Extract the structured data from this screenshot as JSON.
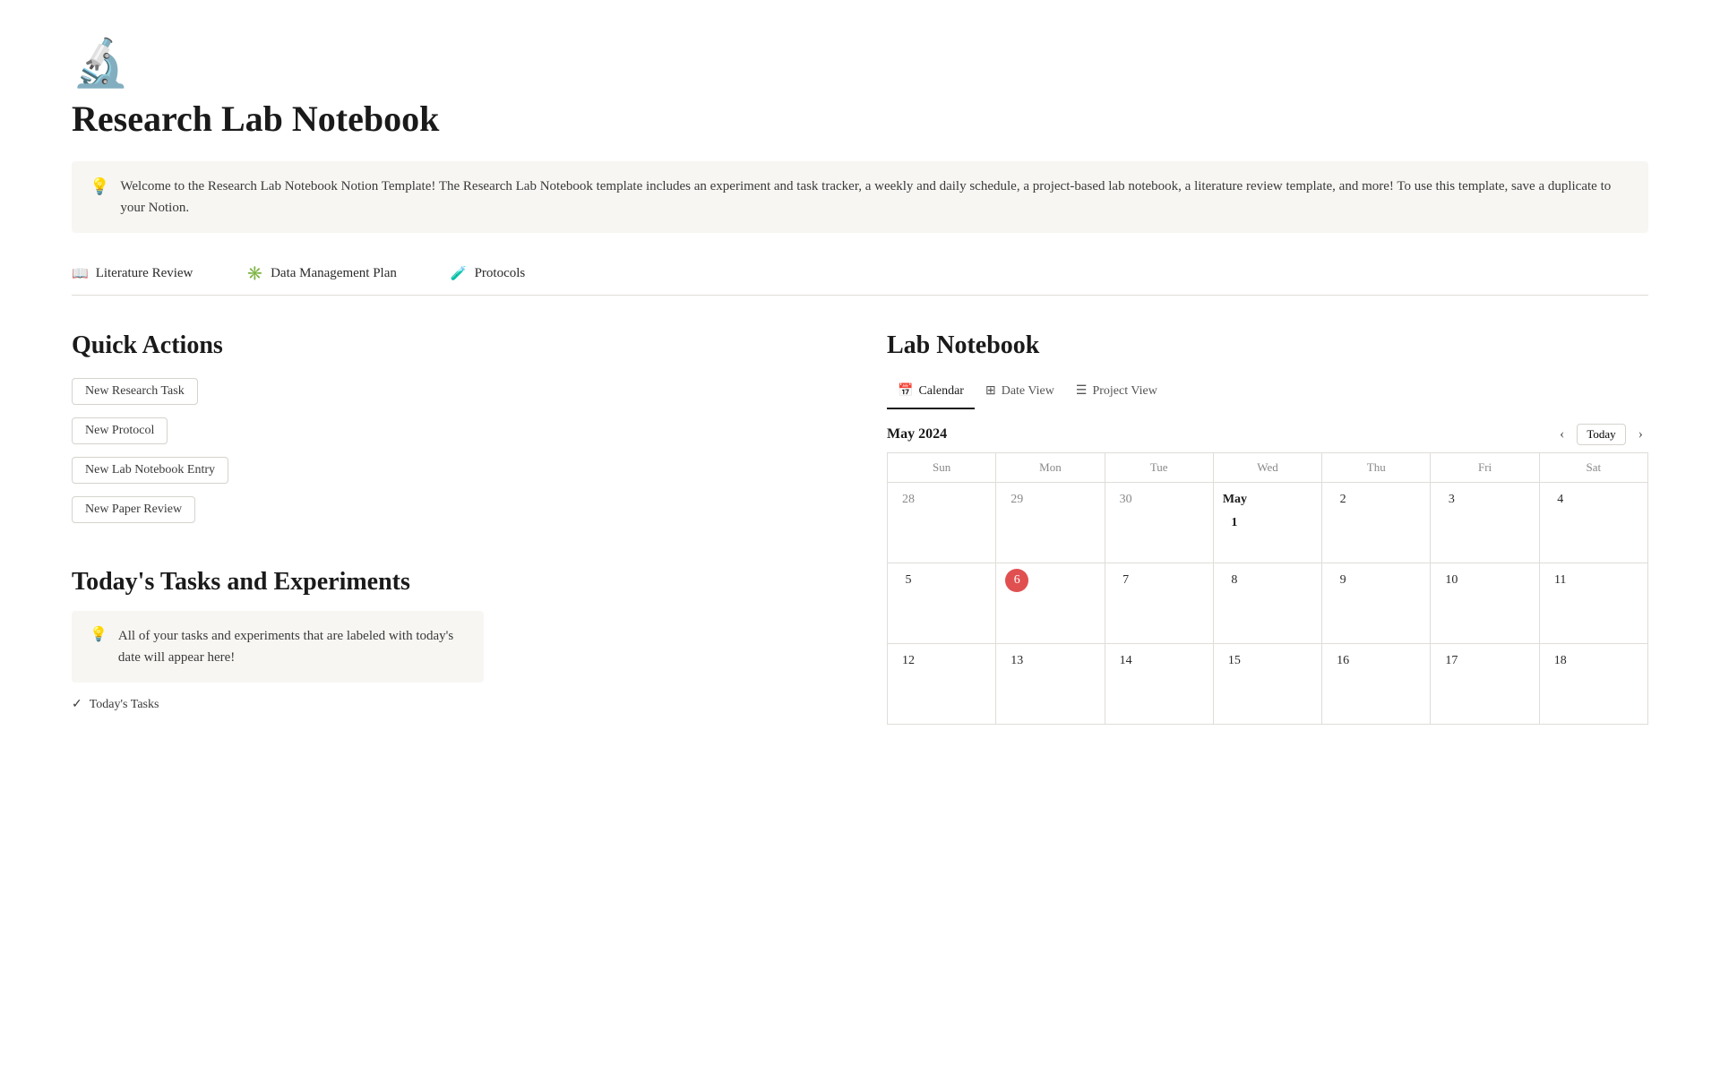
{
  "page": {
    "icon": "🔬",
    "title": "Research Lab Notebook",
    "info_text": "Welcome to the Research Lab Notebook Notion Template!  The Research Lab Notebook template includes an experiment and task tracker, a weekly and daily schedule, a project-based lab notebook, a literature review template, and more! To use this template, save a duplicate to your Notion.",
    "info_icon": "💡"
  },
  "nav": {
    "items": [
      {
        "label": "Literature Review",
        "icon": "📖"
      },
      {
        "label": "Data Management Plan",
        "icon": "✳️"
      },
      {
        "label": "Protocols",
        "icon": "🧪"
      }
    ]
  },
  "quick_actions": {
    "title": "Quick Actions",
    "buttons": [
      {
        "label": "New Research Task"
      },
      {
        "label": "New Protocol"
      },
      {
        "label": "New Lab Notebook Entry"
      },
      {
        "label": "New Paper Review"
      }
    ]
  },
  "todays_tasks": {
    "title": "Today's Tasks and Experiments",
    "info_icon": "💡",
    "info_text": "All of your tasks and experiments that are labeled with today's date will appear here!",
    "check_label": "Today's Tasks"
  },
  "lab_notebook": {
    "title": "Lab Notebook",
    "tabs": [
      {
        "label": "Calendar",
        "icon": "📅",
        "active": true
      },
      {
        "label": "Date View",
        "icon": "⚏"
      },
      {
        "label": "Project View",
        "icon": "☰"
      }
    ],
    "calendar": {
      "month_year": "May 2024",
      "today_label": "Today",
      "days_of_week": [
        "Sun",
        "Mon",
        "Tue",
        "Wed",
        "Thu",
        "Fri",
        "Sat"
      ],
      "weeks": [
        [
          {
            "day": "28",
            "current": false
          },
          {
            "day": "29",
            "current": false
          },
          {
            "day": "30",
            "current": false
          },
          {
            "day": "May 1",
            "current": true,
            "bold": true
          },
          {
            "day": "2",
            "current": true
          },
          {
            "day": "3",
            "current": true
          },
          {
            "day": "4",
            "current": true
          }
        ],
        [
          {
            "day": "5",
            "current": true
          },
          {
            "day": "6",
            "current": true,
            "today": true
          },
          {
            "day": "7",
            "current": true
          },
          {
            "day": "8",
            "current": true
          },
          {
            "day": "9",
            "current": true
          },
          {
            "day": "10",
            "current": true
          },
          {
            "day": "11",
            "current": true
          }
        ],
        [
          {
            "day": "12",
            "current": true
          },
          {
            "day": "13",
            "current": true
          },
          {
            "day": "14",
            "current": true
          },
          {
            "day": "15",
            "current": true
          },
          {
            "day": "16",
            "current": true
          },
          {
            "day": "17",
            "current": true
          },
          {
            "day": "18",
            "current": true
          }
        ]
      ]
    }
  }
}
